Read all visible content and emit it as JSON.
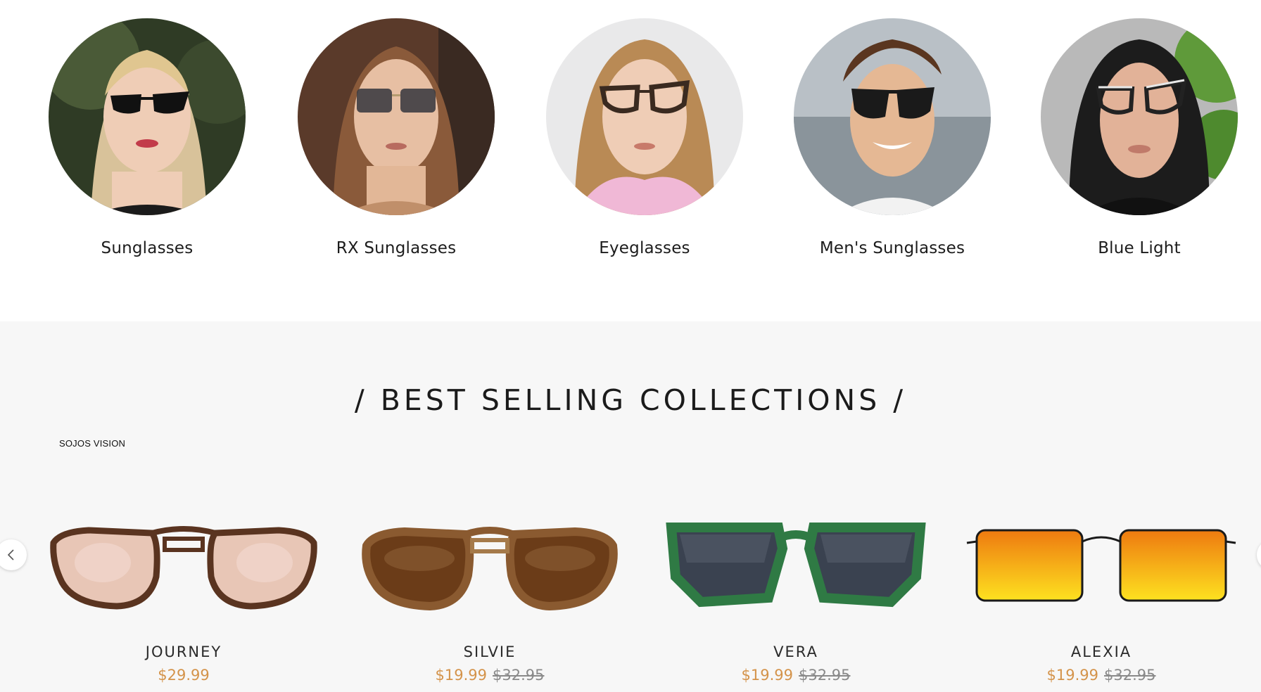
{
  "categories": [
    {
      "label": "Sunglasses",
      "image": "woman-black-cat-eye-sunglasses"
    },
    {
      "label": "RX Sunglasses",
      "image": "woman-square-gradient-sunglasses"
    },
    {
      "label": "Eyeglasses",
      "image": "woman-tortoise-cat-eye-eyeglasses"
    },
    {
      "label": "Men's Sunglasses",
      "image": "man-aviator-sunglasses-beach"
    },
    {
      "label": "Blue Light",
      "image": "woman-crystal-cat-eye-glasses"
    }
  ],
  "best_sellers": {
    "title": "/ BEST SELLING COLLECTIONS /",
    "brand_label": "SOJOS VISION",
    "products": [
      {
        "name": "JOURNEY",
        "price": "$29.99",
        "old_price": ""
      },
      {
        "name": "SILVIE",
        "price": "$19.99",
        "old_price": "$32.95"
      },
      {
        "name": "VERA",
        "price": "$19.99",
        "old_price": "$32.95"
      },
      {
        "name": "ALEXIA",
        "price": "$19.99",
        "old_price": "$32.95"
      }
    ]
  },
  "icons": {
    "prev": "chevron-left-icon",
    "next": "chevron-right-icon"
  },
  "colors": {
    "sale_price": "#d4934a",
    "old_price": "#8a8a8a",
    "section_bg": "#f7f7f7"
  }
}
